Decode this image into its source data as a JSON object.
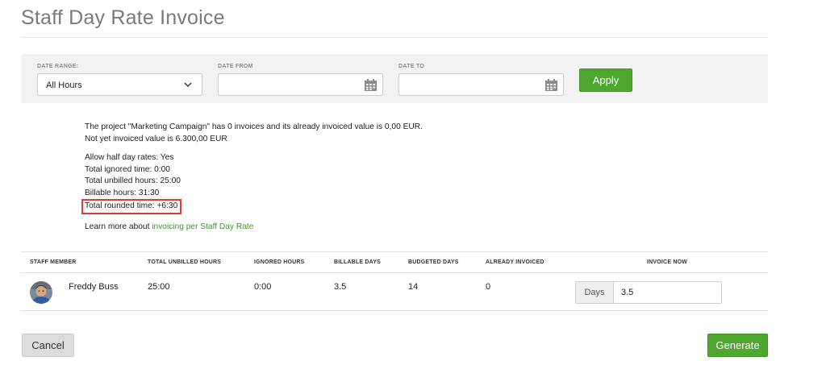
{
  "page": {
    "title": "Staff Day Rate Invoice"
  },
  "filters": {
    "date_range": {
      "label": "DATE RANGE:",
      "value": "All Hours"
    },
    "date_from": {
      "label": "DATE FROM",
      "value": ""
    },
    "date_to": {
      "label": "DATE TO",
      "value": ""
    },
    "apply_label": "Apply"
  },
  "info": {
    "project_line": "The project \"Marketing Campaign\" has 0 invoices and its already invoiced value is 0,00 EUR.",
    "not_invoiced_line": "Not yet invoiced value is 6.300,00 EUR",
    "half_day": "Allow half day rates: Yes",
    "ignored_time": "Total ignored time: 0:00",
    "unbilled_hours": "Total unbilled hours: 25:00",
    "billable_hours": "Billable hours: 31:30",
    "rounded_time": "Total rounded time: +6:30",
    "learn_more_prefix": "Learn more about",
    "learn_more_link": "invoicing per Staff Day Rate"
  },
  "table": {
    "headers": {
      "staff_member": "STAFF MEMBER",
      "total_unbilled": "TOTAL UNBILLED HOURS",
      "ignored_hours": "IGNORED HOURS",
      "billable_days": "BILLABLE DAYS",
      "budgeted_days": "BUDGETED DAYS",
      "already_invoiced": "ALREADY INVOICED",
      "invoice_now": "INVOICE NOW"
    },
    "rows": [
      {
        "name": "Freddy Buss",
        "total_unbilled": "25:00",
        "ignored_hours": "0:00",
        "billable_days": "3.5",
        "budgeted_days": "14",
        "already_invoiced": "0",
        "invoice_unit": "Days",
        "invoice_value": "3.5"
      }
    ]
  },
  "actions": {
    "cancel_label": "Cancel",
    "generate_label": "Generate"
  },
  "colors": {
    "accent_green": "#4ea72e",
    "highlight_red": "#e53935",
    "link_green": "#3f9b2a"
  },
  "icons": {
    "date_range_toggle": "chevron-down-icon",
    "date_picker": "calendar-icon",
    "user_avatar": "avatar"
  }
}
